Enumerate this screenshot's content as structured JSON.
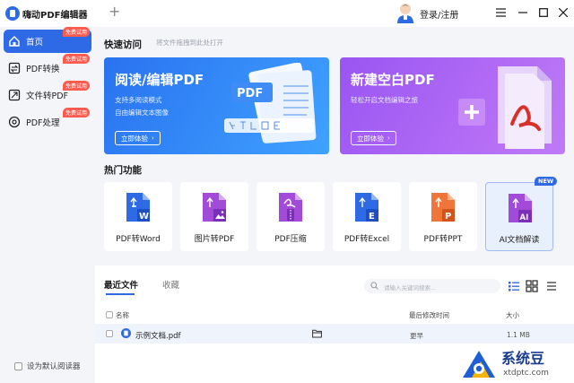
{
  "app": {
    "title": "嗨动PDF编辑器",
    "new_tab_symbol": "+"
  },
  "header": {
    "login_label": "登录/注册"
  },
  "sidebar": {
    "items": [
      {
        "label": "首页",
        "badge": "免费试用",
        "icon": "home-icon",
        "active": true
      },
      {
        "label": "PDF转换",
        "badge": "免费试用",
        "icon": "convert-icon",
        "active": false
      },
      {
        "label": "文件转PDF",
        "badge": "免费试用",
        "icon": "file-to-pdf-icon",
        "active": false
      },
      {
        "label": "PDF处理",
        "badge": "免费试用",
        "icon": "process-icon",
        "active": false
      }
    ],
    "default_reader_label": "设为默认阅读器"
  },
  "quick_access": {
    "title": "快速访问",
    "hint": "将文件拖拽到此处打开",
    "cards": [
      {
        "title": "阅读/编辑PDF",
        "sub1": "支持多阅读模式",
        "sub2": "自由编辑文本图像",
        "button": "立即体验",
        "color": "#2a72f0"
      },
      {
        "title": "新建空白PDF",
        "sub1": "轻松开启文档编辑之旅",
        "button": "立即体验",
        "color": "#9a55f2"
      }
    ]
  },
  "hot_features": {
    "title": "热门功能",
    "new_badge": "NEW",
    "items": [
      {
        "label": "PDF转Word",
        "icon": "pdf-to-word-icon",
        "letter": "W",
        "color": "#2f6ae6"
      },
      {
        "label": "图片转PDF",
        "icon": "image-to-pdf-icon",
        "letter": "",
        "color": "#a24bd8"
      },
      {
        "label": "PDF压缩",
        "icon": "pdf-compress-icon",
        "letter": "",
        "color": "#a24bd8"
      },
      {
        "label": "PDF转Excel",
        "icon": "pdf-to-excel-icon",
        "letter": "E",
        "color": "#2f6ae6"
      },
      {
        "label": "PDF转PPT",
        "icon": "pdf-to-ppt-icon",
        "letter": "P",
        "color": "#f0753a"
      },
      {
        "label": "AI文档解读",
        "icon": "ai-document-icon",
        "letter": "AI",
        "color": "#a24bd8"
      }
    ]
  },
  "recent": {
    "tabs": [
      "最近文件",
      "收藏"
    ],
    "search_placeholder": "请输入关键词搜索...",
    "columns": {
      "name": "名称",
      "modified": "最后修改时间",
      "size": "大小"
    },
    "rows": [
      {
        "name": "示例文档.pdf",
        "modified": "更早",
        "size": "1.1 MB"
      }
    ]
  },
  "watermark": {
    "text": "系统豆",
    "url": "xtdptc.com"
  }
}
